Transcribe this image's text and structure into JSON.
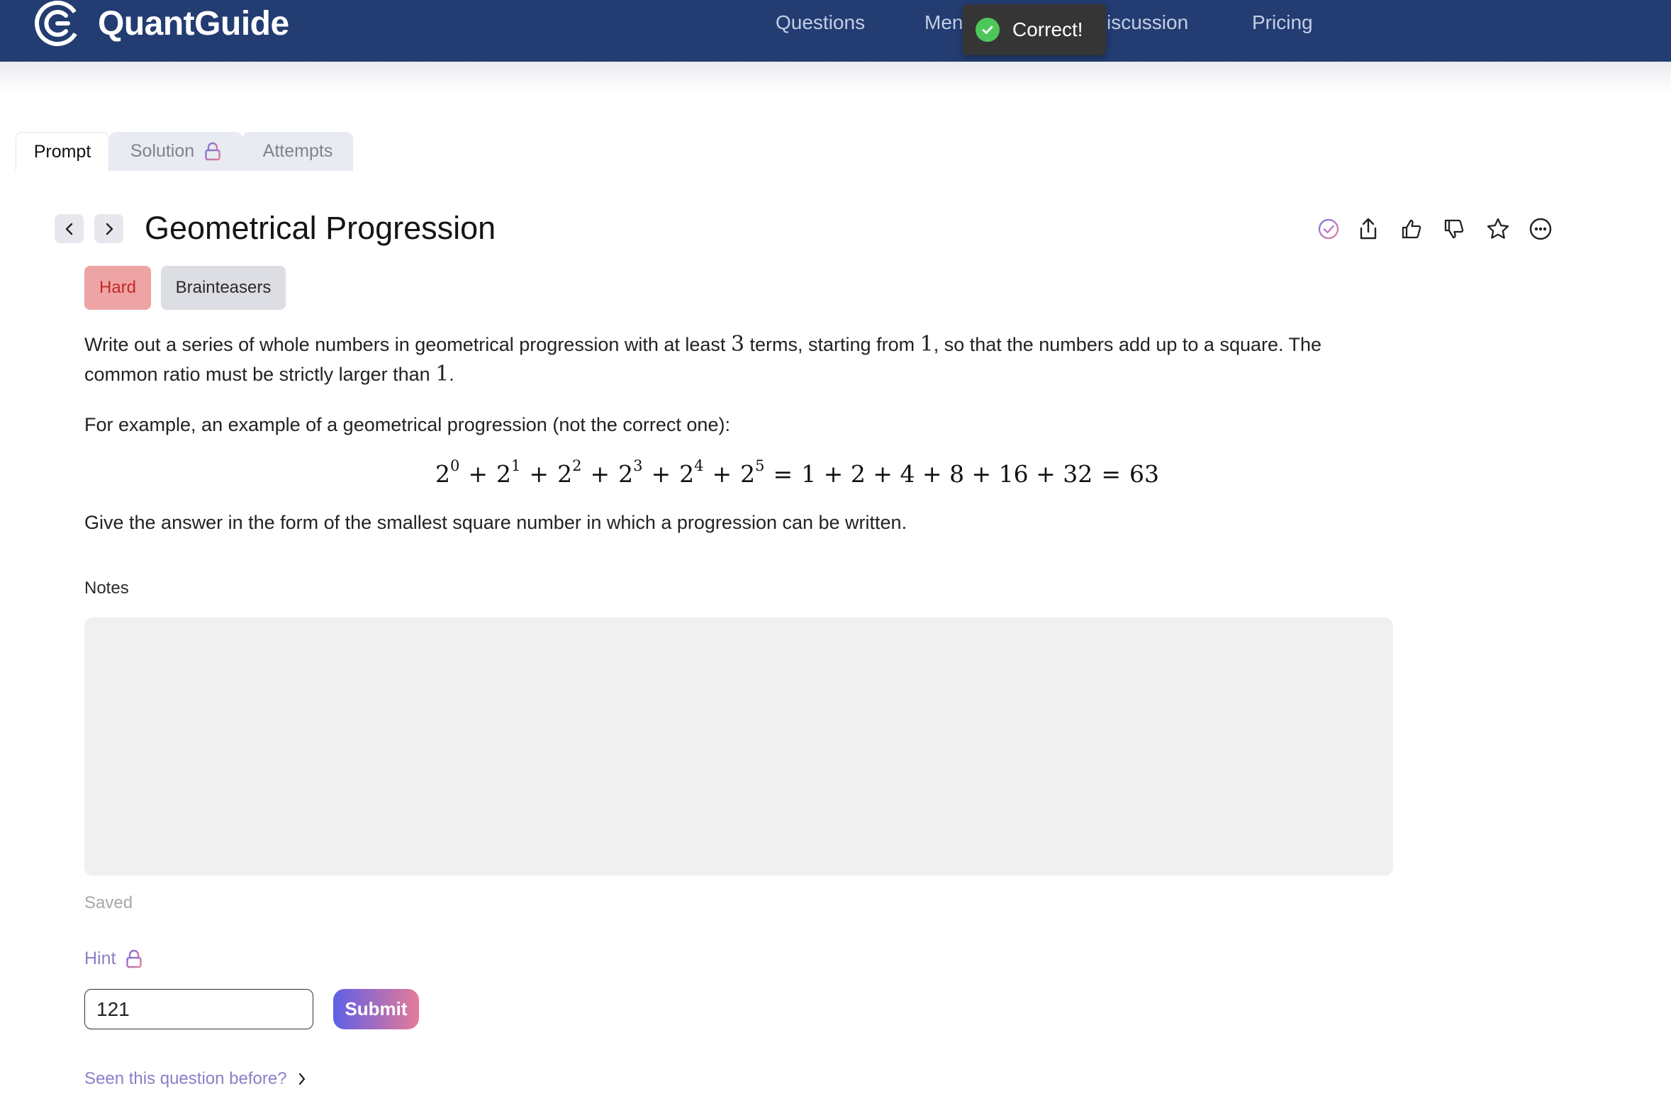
{
  "brand": {
    "name": "QuantGuide"
  },
  "nav": {
    "questions": "Questions",
    "mentorship_partial": "Men",
    "discussion_partial": "iscussion",
    "pricing": "Pricing"
  },
  "toast": {
    "text": "Correct!",
    "icon": "check-circle-icon",
    "color": "#4ec75a"
  },
  "tabs": {
    "prompt": "Prompt",
    "solution": "Solution",
    "attempts": "Attempts"
  },
  "question": {
    "title": "Geometrical Progression",
    "difficulty": "Hard",
    "category": "Brainteasers",
    "p1_a": "Write out a series of whole numbers in geometrical progression with at least ",
    "p1_n1": "3",
    "p1_b": " terms, starting from ",
    "p1_n2": "1",
    "p1_c": ", so that the numbers add up to a square. The",
    "p1_d": "common ratio must be strictly larger than ",
    "p1_n3": "1",
    "p1_e": ".",
    "p2": "For example, an example of a geometrical progression (not the correct one):",
    "equation": {
      "base": "2",
      "exponents": [
        "0",
        "1",
        "2",
        "3",
        "4",
        "5"
      ],
      "plus": "+",
      "equals": "=",
      "expanded": "1 + 2 + 4 + 8 + 16 + 32",
      "total": "63"
    },
    "p3": "Give the answer in the form of the smallest square number in which a progression can be written."
  },
  "notes": {
    "label": "Notes",
    "value": "",
    "status": "Saved"
  },
  "hint": {
    "label": "Hint"
  },
  "answer": {
    "value": "121",
    "submit_label": "Submit"
  },
  "seen_before": {
    "label": "Seen this question before?"
  },
  "colors": {
    "nav_bg": "#233d72",
    "difficulty_bg": "#eea4a4",
    "difficulty_text": "#c42828",
    "accent": "#8a7fc8"
  }
}
